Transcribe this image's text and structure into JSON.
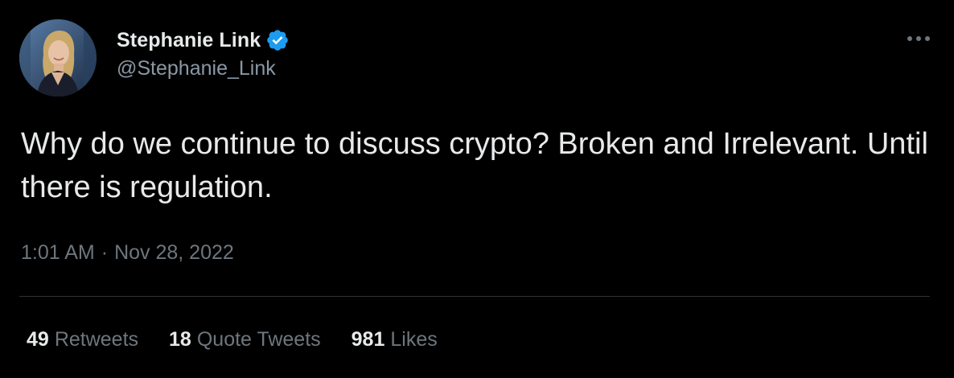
{
  "author": {
    "display_name": "Stephanie Link",
    "handle": "@Stephanie_Link",
    "verified": true,
    "avatar_icon": "profile-photo"
  },
  "tweet": {
    "text": "Why do we continue to discuss crypto? Broken and Irrelevant. Until there is regulation.",
    "time": "1:01 AM",
    "separator": "·",
    "date": "Nov 28, 2022"
  },
  "stats": [
    {
      "count": "49",
      "label": "Retweets"
    },
    {
      "count": "18",
      "label": "Quote Tweets"
    },
    {
      "count": "981",
      "label": "Likes"
    }
  ],
  "icons": {
    "verified": "verified-badge-icon",
    "more": "more-options-icon"
  },
  "colors": {
    "background": "#000000",
    "primary_text": "#e7e9ea",
    "secondary_text": "#6e767d",
    "handle_text": "#8b98a5",
    "verified_blue": "#1d9bf0",
    "divider": "#2f3336"
  }
}
